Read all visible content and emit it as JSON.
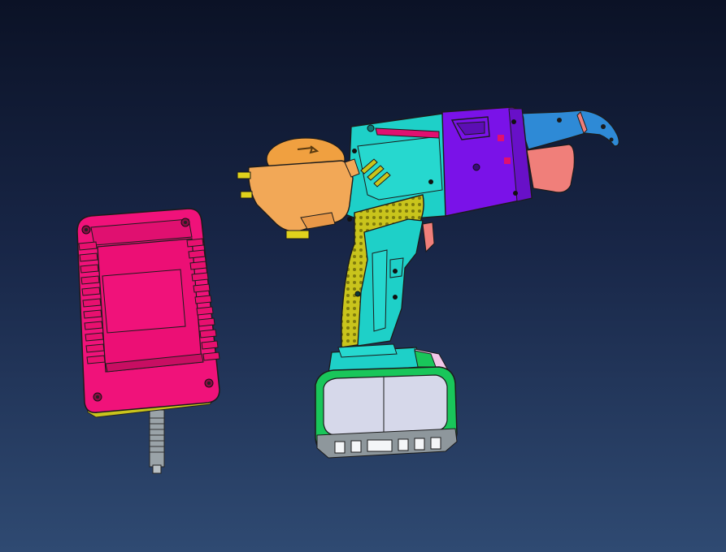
{
  "viewport": {
    "background_top": "#0b1226",
    "background_bottom": "#2f4a72"
  },
  "parts": {
    "charger": {
      "name": "charger",
      "color": "#f0127a",
      "icon": "charger-icon"
    },
    "cable": {
      "name": "charger-cable",
      "color": "#9aa3a8"
    },
    "drum_cover": {
      "name": "wire-drum-cover",
      "color": "#f2a857"
    },
    "drum_reel": {
      "name": "wire-reel",
      "color": "#f0a040"
    },
    "body_cyan": {
      "name": "tool-body-shell",
      "color": "#1ed0c8"
    },
    "body_purple": {
      "name": "motor-housing",
      "color": "#7a12e8"
    },
    "nose": {
      "name": "nose-guide",
      "color": "#2e8ad6"
    },
    "nose_lower": {
      "name": "lower-jaw",
      "color": "#f07f7a"
    },
    "grip": {
      "name": "grip-panel",
      "color": "#c9c41c"
    },
    "trigger": {
      "name": "trigger",
      "color": "#f07f7a"
    },
    "battery_frame": {
      "name": "battery-frame",
      "color": "#19c65a"
    },
    "battery_face": {
      "name": "battery-face",
      "color": "#d6d8ea"
    }
  }
}
